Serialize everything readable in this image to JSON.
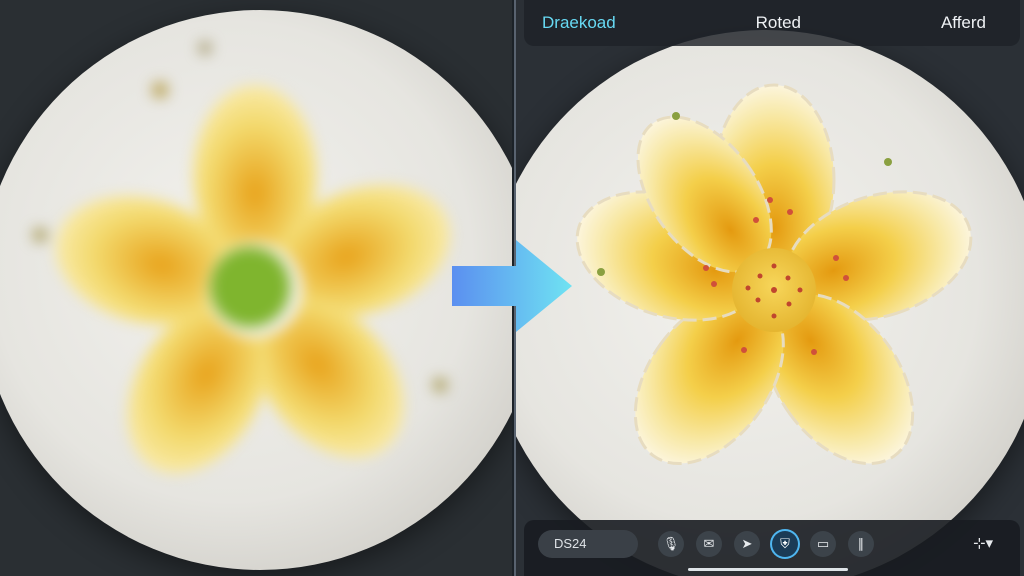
{
  "header": {
    "left_label": "Draekoad",
    "center_label": "Roted",
    "right_label": "Afferd"
  },
  "toolbar": {
    "pill_label": "DS24",
    "tools": [
      {
        "icon": "microphone-icon",
        "glyph": "🎙"
      },
      {
        "icon": "inbox-icon",
        "glyph": "✉"
      },
      {
        "icon": "forward-icon",
        "glyph": "➤"
      },
      {
        "icon": "shield-icon",
        "glyph": "⛨"
      },
      {
        "icon": "screen-icon",
        "glyph": "▭"
      },
      {
        "icon": "waveform-icon",
        "glyph": "∥"
      }
    ],
    "more_glyph": "⊹▾",
    "progress": 1.0
  },
  "colors": {
    "accent": "#67d9f3",
    "arrow_start": "#5b8ff0",
    "arrow_end": "#6fe3f2",
    "active_ring": "#4fb6f0"
  }
}
